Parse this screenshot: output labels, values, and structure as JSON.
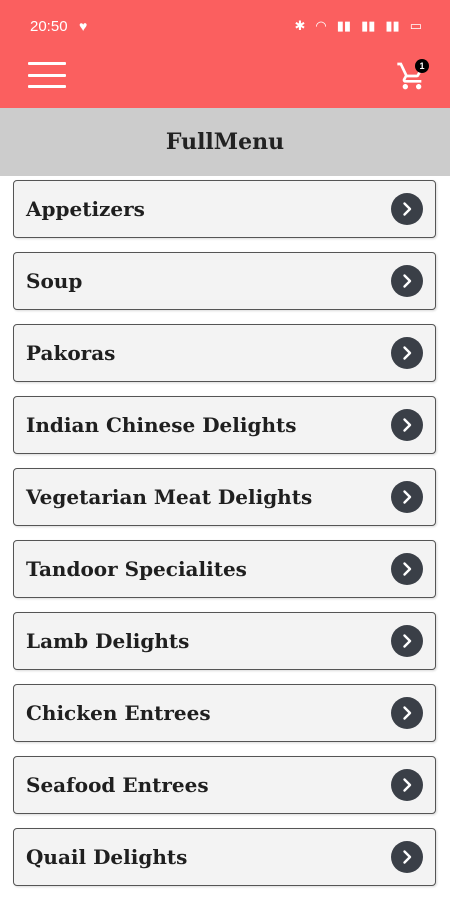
{
  "status": {
    "time": "20:50",
    "heart": "♥",
    "icons": [
      "✱",
      "◠",
      "▮▮",
      "▮▮",
      "▮▮",
      "▭"
    ]
  },
  "header": {
    "cart_count": "1"
  },
  "page": {
    "title": "FullMenu"
  },
  "categories": [
    {
      "label": "Appetizers"
    },
    {
      "label": "Soup"
    },
    {
      "label": "Pakoras"
    },
    {
      "label": "Indian Chinese Delights"
    },
    {
      "label": "Vegetarian Meat Delights"
    },
    {
      "label": "Tandoor Specialites"
    },
    {
      "label": "Lamb Delights"
    },
    {
      "label": "Chicken Entrees"
    },
    {
      "label": "Seafood Entrees"
    },
    {
      "label": "Quail Delights"
    }
  ],
  "colors": {
    "appbar": "#fb5f5f",
    "title_band": "#cccccc",
    "item_bg": "#f3f3f3",
    "chevron_bg": "#3a3f47"
  }
}
